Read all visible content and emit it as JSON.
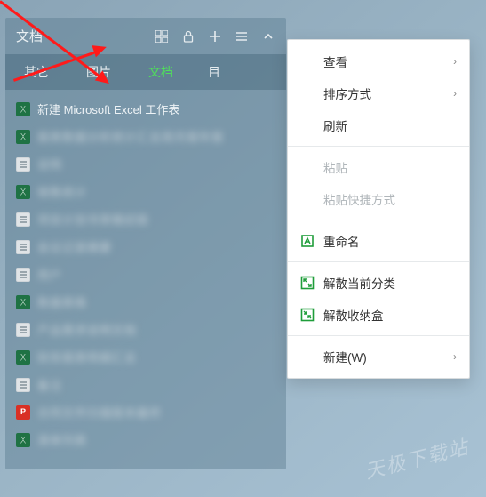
{
  "panel": {
    "title": "文档",
    "tabs": [
      {
        "label": "其它",
        "active": false
      },
      {
        "label": "图片",
        "active": false
      },
      {
        "label": "文档",
        "active": true
      },
      {
        "label": "目",
        "active": false
      }
    ],
    "files": [
      {
        "icon": "excel",
        "name": "新建 Microsoft Excel 工作表",
        "blurred": false
      },
      {
        "icon": "excel",
        "name": "报表数据分析统计汇总周月报年报",
        "blurred": true
      },
      {
        "icon": "doc",
        "name": "说明",
        "blurred": true
      },
      {
        "icon": "excel",
        "name": "销售统计",
        "blurred": true
      },
      {
        "icon": "doc",
        "name": "项目计划书草稿初版",
        "blurred": true
      },
      {
        "icon": "doc",
        "name": "会议记录摘要",
        "blurred": true
      },
      {
        "icon": "doc",
        "name": "用户",
        "blurred": true
      },
      {
        "icon": "excel",
        "name": "数据表格",
        "blurred": true
      },
      {
        "icon": "doc",
        "name": "产品需求说明文档",
        "blurred": true
      },
      {
        "icon": "excel",
        "name": "财务报表明细汇总",
        "blurred": true
      },
      {
        "icon": "doc",
        "name": "备注",
        "blurred": true
      },
      {
        "icon": "pdf",
        "name": "合同文件扫描版本最终",
        "blurred": true
      },
      {
        "icon": "excel",
        "name": "清单列表",
        "blurred": true
      }
    ]
  },
  "menu": {
    "groups": [
      [
        {
          "key": "view",
          "label": "查看",
          "icon": "",
          "submenu": true,
          "disabled": false
        },
        {
          "key": "sort",
          "label": "排序方式",
          "icon": "",
          "submenu": true,
          "disabled": false
        },
        {
          "key": "refresh",
          "label": "刷新",
          "icon": "",
          "submenu": false,
          "disabled": false
        }
      ],
      [
        {
          "key": "paste",
          "label": "粘贴",
          "icon": "",
          "submenu": false,
          "disabled": true
        },
        {
          "key": "paste-shortcut",
          "label": "粘贴快捷方式",
          "icon": "",
          "submenu": false,
          "disabled": true
        }
      ],
      [
        {
          "key": "rename",
          "label": "重命名",
          "icon": "rename",
          "submenu": false,
          "disabled": false
        }
      ],
      [
        {
          "key": "dissolve-category",
          "label": "解散当前分类",
          "icon": "expand",
          "submenu": false,
          "disabled": false
        },
        {
          "key": "dissolve-box",
          "label": "解散收纳盒",
          "icon": "collapse",
          "submenu": false,
          "disabled": false
        }
      ],
      [
        {
          "key": "new",
          "label": "新建(W)",
          "icon": "",
          "submenu": true,
          "disabled": false
        }
      ]
    ]
  },
  "watermark": "天极下载站"
}
